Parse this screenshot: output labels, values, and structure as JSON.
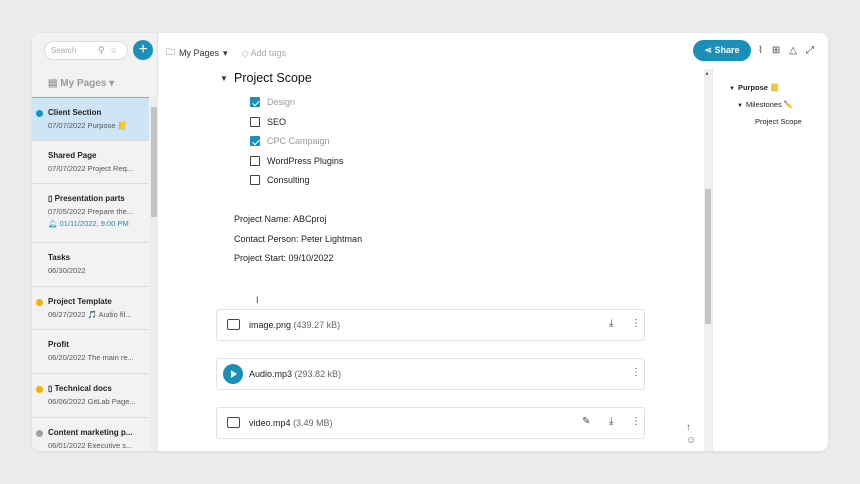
{
  "sidebar": {
    "search_placeholder": "Search",
    "add_label": "+",
    "title": "My Pages",
    "pages": [
      {
        "name": "Client Section",
        "meta": "07/07/2022 Purpose 📒",
        "dot": "#1a90b8"
      },
      {
        "name": "Shared Page",
        "meta": "07/07/2022 Project Req..."
      },
      {
        "name": "Presentation parts",
        "meta": "07/05/2022 Prepare the...",
        "reminder": "01/11/2022, 9:00 PM"
      },
      {
        "name": "Tasks",
        "meta": "06/30/2022"
      },
      {
        "name": "Project Template",
        "meta": "06/27/2022 🎵 Audio fil...",
        "dot": "#f0b400"
      },
      {
        "name": "Profit",
        "meta": "06/20/2022 The main re..."
      },
      {
        "name": "Technical docs",
        "meta": "06/06/2022 GitLab Page...",
        "dot": "#f0b400"
      },
      {
        "name": "Content marketing p...",
        "meta": "06/01/2022 Executive s...",
        "dot": "#9aa0a6"
      }
    ]
  },
  "topbar": {
    "breadcrumb": "My Pages",
    "add_tags": "Add tags",
    "share_label": "Share"
  },
  "content": {
    "section_title": "Project Scope",
    "checklist": [
      {
        "label": "Design",
        "checked": true
      },
      {
        "label": "SEO",
        "checked": false
      },
      {
        "label": "CPC Campaign",
        "checked": true
      },
      {
        "label": "WordPress Plugins",
        "checked": false
      },
      {
        "label": "Consulting",
        "checked": false
      }
    ],
    "info": [
      "Project Name: ABCproj",
      "Contact Person: Peter Lightman",
      "Project Start: 09/10/2022"
    ],
    "files": [
      {
        "name": "image.png",
        "size": "(439.27 kB)",
        "type": "image"
      },
      {
        "name": "Audio.mp3",
        "size": "(293.82 kB)",
        "type": "audio"
      },
      {
        "name": "video.mp4",
        "size": "(3.49 MB)",
        "type": "video"
      }
    ]
  },
  "outline": {
    "items": [
      "Purpose 📒",
      "Milestones ✏️",
      "Project Scope"
    ]
  }
}
